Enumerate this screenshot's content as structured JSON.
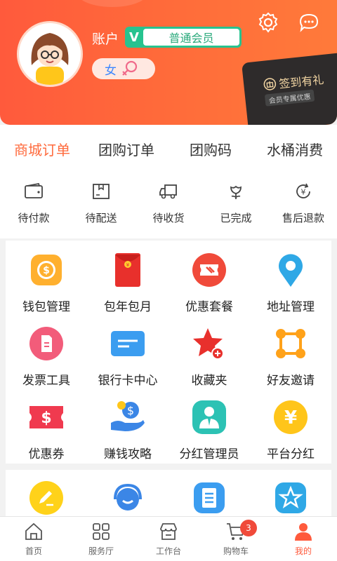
{
  "header": {
    "account_label": "账户",
    "vip_letter": "V",
    "member_level": "普通会员",
    "gender": "女",
    "signin": {
      "title": "签到有礼",
      "subtitle": "会员专属优惠"
    }
  },
  "order_tabs": [
    "商城订单",
    "团购订单",
    "团购码",
    "水桶消费"
  ],
  "order_status": [
    {
      "label": "待付款",
      "icon": "wallet-icon"
    },
    {
      "label": "待配送",
      "icon": "package-icon"
    },
    {
      "label": "待收货",
      "icon": "truck-icon"
    },
    {
      "label": "已完成",
      "icon": "flower-icon"
    },
    {
      "label": "售后退款",
      "icon": "refund-icon"
    }
  ],
  "services": [
    {
      "label": "钱包管理",
      "icon": "coin-wallet-icon",
      "color": "#ffb02e"
    },
    {
      "label": "包年包月",
      "icon": "red-envelope-icon",
      "color": "#e8302c"
    },
    {
      "label": "优惠套餐",
      "icon": "ticket-icon",
      "color": "#f04a3a"
    },
    {
      "label": "地址管理",
      "icon": "location-pin-icon",
      "color": "#2fa8e6"
    },
    {
      "label": "发票工具",
      "icon": "invoice-icon",
      "color": "#f25c7a"
    },
    {
      "label": "银行卡中心",
      "icon": "bank-card-icon",
      "color": "#3b9df0"
    },
    {
      "label": "收藏夹",
      "icon": "star-plus-icon",
      "color": "#e8302c"
    },
    {
      "label": "好友邀请",
      "icon": "network-icon",
      "color": "#ffa21a"
    },
    {
      "label": "优惠券",
      "icon": "coupon-icon",
      "color": "#f03a4f"
    },
    {
      "label": "赚钱攻略",
      "icon": "money-hand-icon",
      "color": "#3b86e6"
    },
    {
      "label": "分红管理员",
      "icon": "manager-icon",
      "color": "#2cc2b4"
    },
    {
      "label": "平台分红",
      "icon": "yen-coin-icon",
      "color": "#ffc51a"
    }
  ],
  "services_more": [
    {
      "icon": "edit-icon",
      "color": "#ffd21a"
    },
    {
      "icon": "customer-service-icon",
      "color": "#3b86e6"
    },
    {
      "icon": "document-icon",
      "color": "#3b9df0"
    },
    {
      "icon": "star-badge-icon",
      "color": "#2fa8e6"
    }
  ],
  "bottom_nav": [
    {
      "label": "首页",
      "icon": "home-icon"
    },
    {
      "label": "服务厅",
      "icon": "grid-icon"
    },
    {
      "label": "工作台",
      "icon": "store-icon"
    },
    {
      "label": "购物车",
      "icon": "cart-icon",
      "badge": "3"
    },
    {
      "label": "我的",
      "icon": "profile-icon",
      "active": true
    }
  ],
  "colors": {
    "brand": "#ff5a3c",
    "vip": "#27c38f"
  }
}
